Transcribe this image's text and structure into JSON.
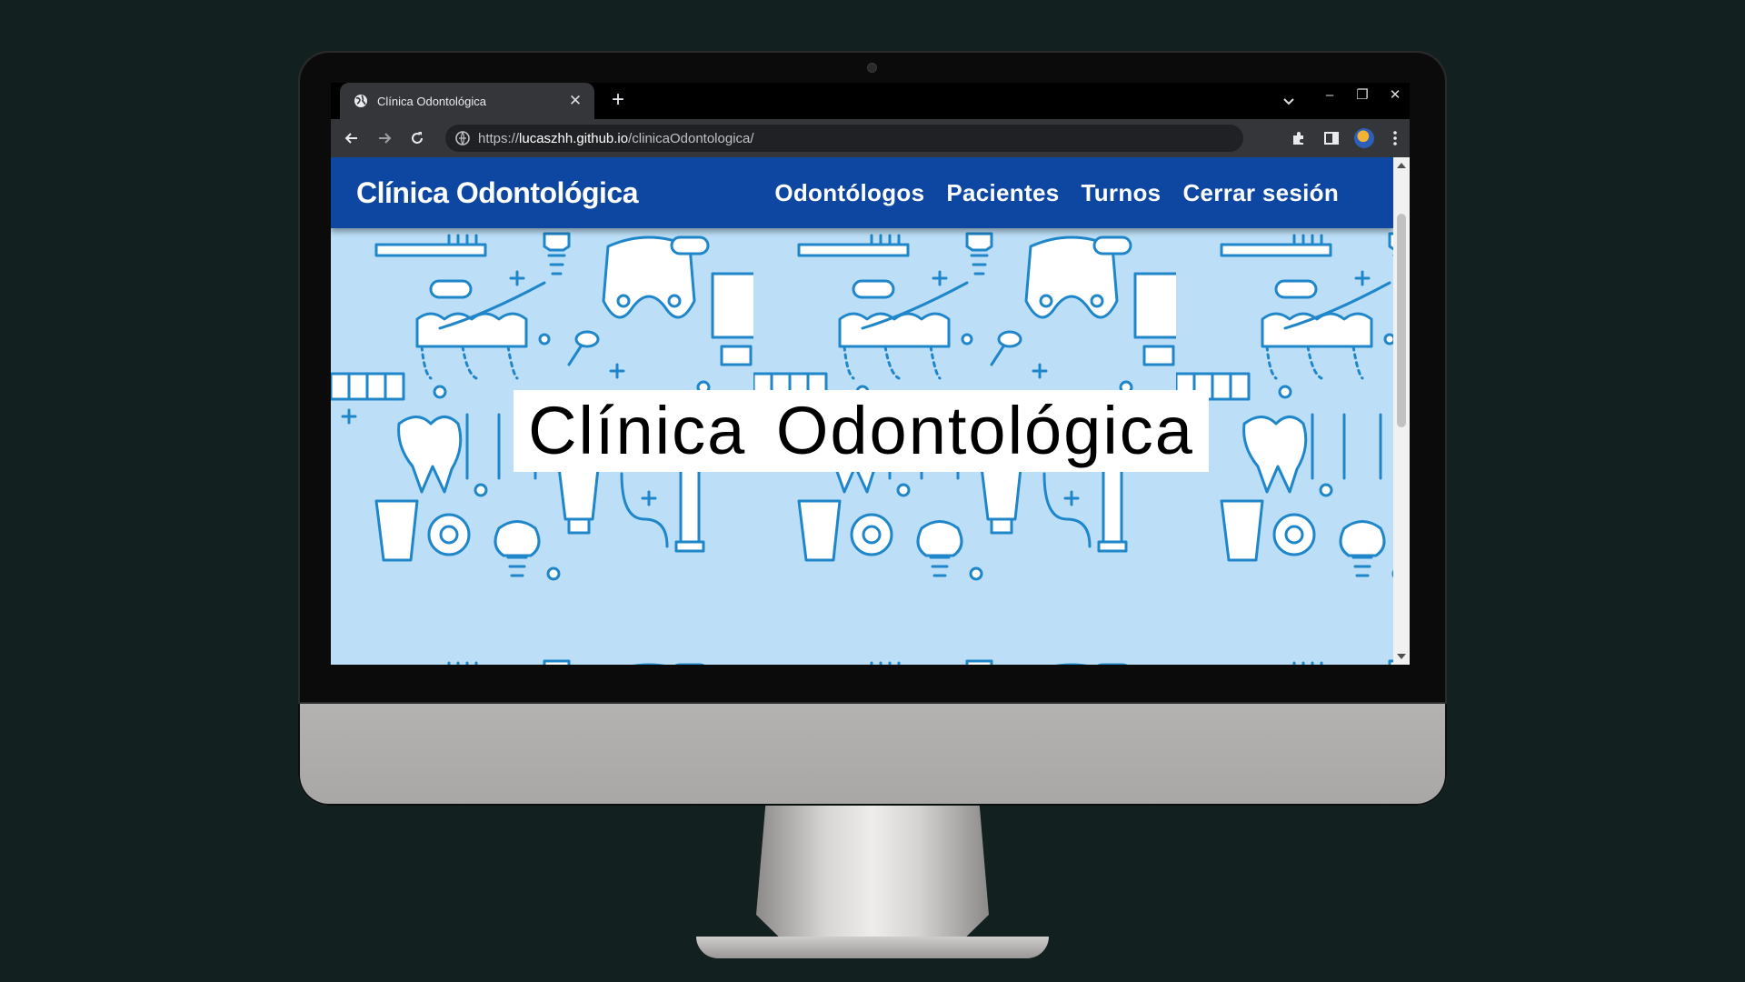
{
  "browser": {
    "tab_title": "Clínica Odontológica",
    "tab_close": "✕",
    "new_tab": "+",
    "url_scheme": "https://",
    "url_host": "lucaszhh.github.io",
    "url_path": "/clinicaOdontologica/",
    "window_controls": {
      "minimize": "–",
      "restore": "❐",
      "close": "✕"
    }
  },
  "site": {
    "brand": "Clínica Odontológica",
    "nav": [
      "Odontólogos",
      "Pacientes",
      "Turnos",
      "Cerrar sesión"
    ],
    "hero_title": "Clínica Odontológica"
  },
  "colors": {
    "nav_bg": "#0d47a1",
    "pattern_bg": "#bcdff7",
    "pattern_stroke": "#1e86c9",
    "page_bg": "#132020"
  }
}
